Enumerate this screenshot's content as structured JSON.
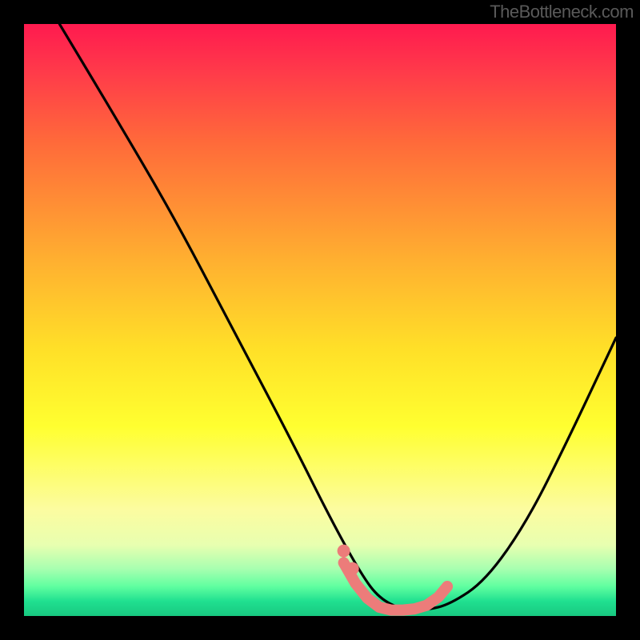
{
  "watermark": "TheBottleneck.com",
  "chart_data": {
    "type": "line",
    "title": "",
    "xlabel": "",
    "ylabel": "",
    "xlim": [
      0,
      100
    ],
    "ylim": [
      0,
      100
    ],
    "series": [
      {
        "name": "curve",
        "x": [
          6,
          15,
          25,
          35,
          45,
          52,
          57,
          60,
          64,
          68,
          72,
          78,
          85,
          92,
          100
        ],
        "y": [
          100,
          85,
          68,
          49,
          30,
          16,
          7,
          3,
          1,
          1,
          2,
          6,
          16,
          30,
          47
        ],
        "color": "#000000"
      },
      {
        "name": "highlight",
        "x": [
          54,
          56,
          58,
          60,
          62,
          64,
          66,
          68,
          70,
          71.5
        ],
        "y": [
          9,
          5.5,
          3,
          1.5,
          1,
          1,
          1.2,
          1.8,
          3.2,
          5
        ],
        "color": "#ec7c7a"
      }
    ],
    "annotations": []
  },
  "colors": {
    "background": "#000000",
    "watermark": "#5a5a5a",
    "curve": "#000000",
    "highlight": "#ec7c7a"
  }
}
